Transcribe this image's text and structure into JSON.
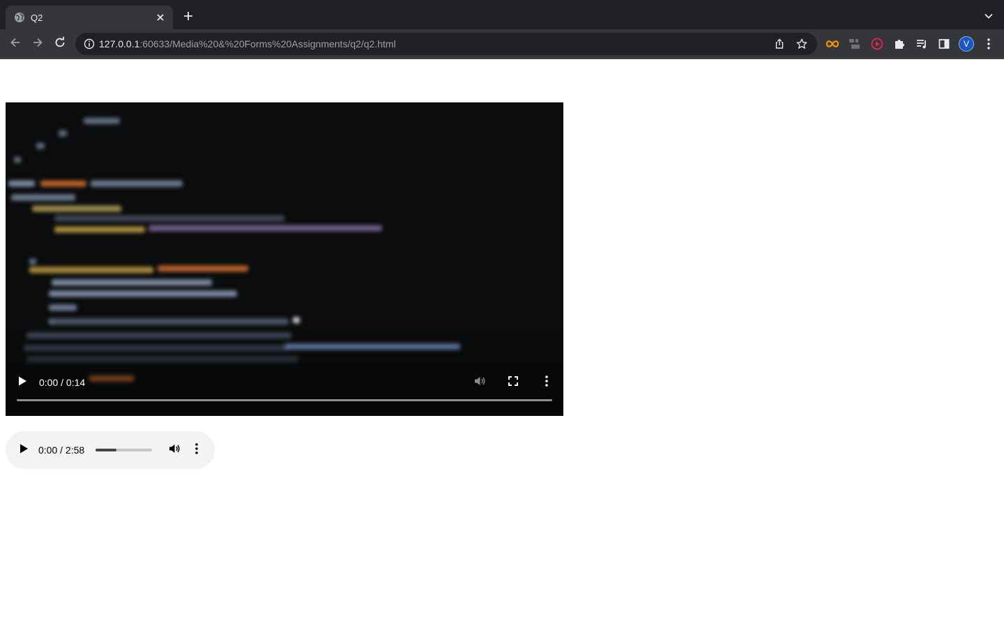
{
  "browser": {
    "tab": {
      "title": "Q2"
    },
    "address_bar": {
      "host": "127.0.0.1",
      "path": ":60633/Media%20&%20Forms%20Assignments/q2/q2.html"
    },
    "profile_initial": "V",
    "accent_color": "#8ab4f8",
    "icons": [
      "globe-icon",
      "close-icon",
      "plus-icon",
      "chevron-down-icon",
      "back-arrow-icon",
      "forward-arrow-icon",
      "reload-icon",
      "info-icon",
      "share-icon",
      "star-icon",
      "infinity-extension-icon",
      "gitzip-extension-icon",
      "record-extension-icon",
      "puzzle-icon",
      "media-queue-icon",
      "side-panel-icon",
      "kebab-menu-icon"
    ]
  },
  "page": {
    "video": {
      "time": "0:00 / 0:14",
      "progress": 0,
      "icons": [
        "play-icon",
        "volume-icon",
        "fullscreen-icon",
        "kebab-menu-icon"
      ]
    },
    "audio": {
      "time": "0:00 / 2:58",
      "progress": 0,
      "timeline_fill": 0.37,
      "icons": [
        "play-icon",
        "volume-icon",
        "kebab-menu-icon"
      ]
    }
  }
}
